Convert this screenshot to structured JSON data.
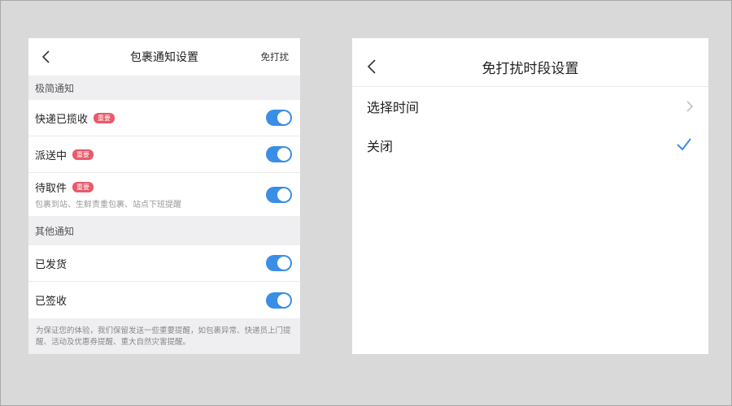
{
  "notification_settings": {
    "title": "包裹通知设置",
    "dnd_link": "免打扰",
    "sections": [
      {
        "header": "极简通知",
        "rows": [
          {
            "label": "快递已揽收",
            "badge": "重要",
            "subtitle": "",
            "enabled": true
          },
          {
            "label": "派送中",
            "badge": "重要",
            "subtitle": "",
            "enabled": true
          },
          {
            "label": "待取件",
            "badge": "重要",
            "subtitle": "包裹到站、生鲜责重包裹、站点下班提醒",
            "enabled": true
          }
        ]
      },
      {
        "header": "其他通知",
        "rows": [
          {
            "label": "已发货",
            "badge": "",
            "subtitle": "",
            "enabled": true
          },
          {
            "label": "已签收",
            "badge": "",
            "subtitle": "",
            "enabled": true
          }
        ]
      }
    ],
    "footer_note": "为保证您的体验，我们保留发送一些重要提醒，如包裹异常、快递员上门提醒、活动及优惠券提醒、重大自然灾害提醒。"
  },
  "dnd_settings": {
    "title": "免打扰时段设置",
    "options": [
      {
        "label": "选择时间",
        "selected": false
      },
      {
        "label": "关闭",
        "selected": true
      }
    ]
  },
  "colors": {
    "toggle_on": "#3a8ee6",
    "badge": "#e85a6a",
    "check": "#3a8ee6"
  }
}
